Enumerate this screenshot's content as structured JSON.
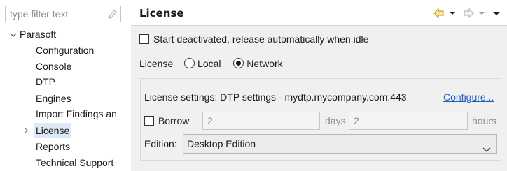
{
  "sidebar": {
    "filter_placeholder": "type filter text",
    "tree": {
      "root_label": "Parasoft",
      "items": [
        {
          "label": "Configuration"
        },
        {
          "label": "Console"
        },
        {
          "label": "DTP"
        },
        {
          "label": "Engines"
        },
        {
          "label": "Import Findings an"
        },
        {
          "label": "License",
          "selected": true
        },
        {
          "label": "Reports"
        },
        {
          "label": "Technical Support"
        }
      ]
    }
  },
  "header": {
    "title": "License",
    "icons": [
      "back-arrow-icon",
      "back-dropdown-icon",
      "forward-arrow-icon",
      "forward-dropdown-icon",
      "view-menu-icon"
    ]
  },
  "main": {
    "start_deactivated_label": "Start deactivated, release automatically when idle",
    "license_label": "License",
    "license_options": [
      "Local",
      "Network"
    ],
    "license_selected": "Network",
    "settings": {
      "text": "License settings: DTP settings - mydtp.mycompany.com:443",
      "configure_link": "Configure...",
      "borrow_label": "Borrow",
      "days_value": "2",
      "days_label": "days",
      "hours_value": "2",
      "hours_label": "hours",
      "edition_label": "Edition:",
      "edition_value": "Desktop Edition"
    }
  },
  "colors": {
    "accent_link": "#1f5fbf",
    "selection": "#dde8f6",
    "back_arrow": "#e0a020"
  }
}
